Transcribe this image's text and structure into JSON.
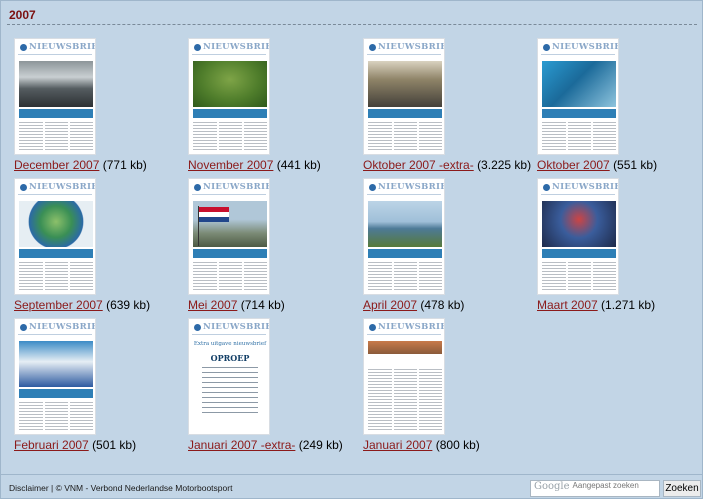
{
  "section": {
    "year": "2007"
  },
  "newsletter": {
    "masthead": "NIEUWSBRIEF"
  },
  "items": [
    {
      "title": "December 2007",
      "size": "(771 kb)",
      "photo": "boat"
    },
    {
      "title": "November 2007",
      "size": "(441 kb)",
      "photo": "map"
    },
    {
      "title": "Oktober 2007 -extra-",
      "size": "(3.225 kb)",
      "photo": "crowd"
    },
    {
      "title": "Oktober 2007",
      "size": "(551 kb)",
      "photo": "fair"
    },
    {
      "title": "September 2007",
      "size": "(639 kb)",
      "photo": "globe"
    },
    {
      "title": "Mei 2007",
      "size": "(714 kb)",
      "photo": "flag"
    },
    {
      "title": "April 2007",
      "size": "(478 kb)",
      "photo": "lake"
    },
    {
      "title": "Maart 2007",
      "size": "(1.271 kb)",
      "photo": "people"
    },
    {
      "title": "Februari 2007",
      "size": "(501 kb)",
      "photo": "stand"
    },
    {
      "title": "Januari 2007 -extra-",
      "size": "(249 kb)",
      "photo": "oproep"
    },
    {
      "title": "Januari 2007",
      "size": "(800 kb)",
      "photo": "group"
    }
  ],
  "oproep": {
    "intro": "Extra uitgave nieuwsbrief",
    "heading": "OPROEP"
  },
  "footer": {
    "disclaimer": "Disclaimer",
    "separator": " | ",
    "copyright": "© VNM - Verbond Nederlandse Motorbootsport"
  },
  "search": {
    "google_logo": "Google",
    "placeholder": "Aangepast zoeken",
    "button_label": "Zoeken"
  },
  "colors": {
    "background": "#c2d5e6",
    "link": "#8b1a1a",
    "heading": "#7b1010"
  }
}
